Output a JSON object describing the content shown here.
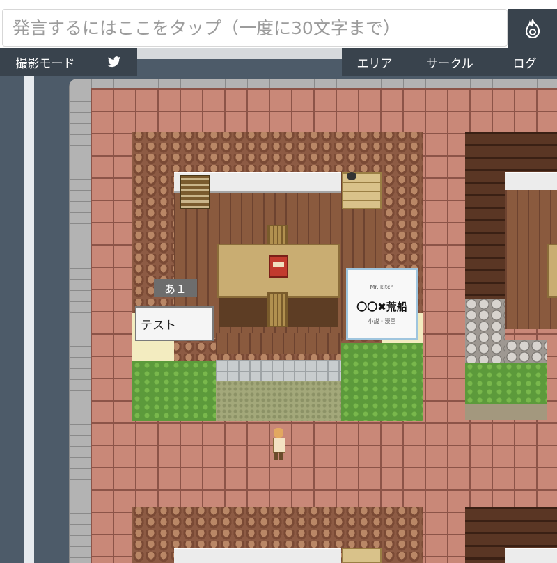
{
  "chat": {
    "placeholder": "発言するにはここをタップ（一度に30文字まで）"
  },
  "send_button": {
    "icon": "flame-icon"
  },
  "nav_left": {
    "photo_mode_label": "撮影モード",
    "twitter_icon": "twitter-bird-icon"
  },
  "nav_right": {
    "area_label": "エリア",
    "circle_label": "サークル",
    "log_label": "ログ"
  },
  "map": {
    "room_number": "あ１",
    "room_name": "テスト",
    "poster": {
      "top_text": "Mr. kitch",
      "title": "〇〇✖荒船",
      "bottom_text": "小説・漫画"
    }
  },
  "colors": {
    "dark_bar": "#39434d",
    "background": "#4d5b69",
    "brick": "#c98878"
  }
}
